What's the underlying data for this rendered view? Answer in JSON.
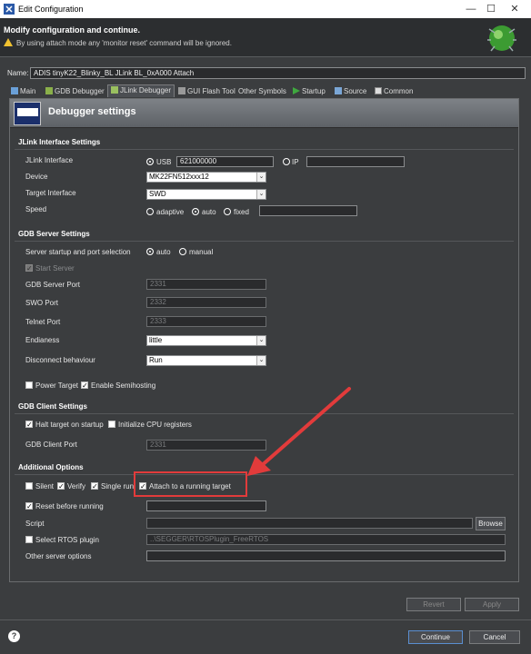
{
  "window": {
    "title": "Edit Configuration",
    "minimize": "—",
    "maximize": "☐",
    "close": "✕"
  },
  "header": {
    "title": "Modify configuration and continue.",
    "warning": "By using attach mode any 'monitor reset' command will be ignored."
  },
  "name": {
    "label": "Name:",
    "value": "ADIS tinyK22_Blinky_BL JLink BL_0xA000 Attach"
  },
  "tabs": [
    {
      "label": "Main"
    },
    {
      "label": "GDB Debugger"
    },
    {
      "label": "JLink Debugger",
      "active": true
    },
    {
      "label": "GUI Flash Tool"
    },
    {
      "label": "Other Symbols"
    },
    {
      "label": "Startup"
    },
    {
      "label": "Source"
    },
    {
      "label": "Common"
    }
  ],
  "banner": {
    "title": "Debugger settings",
    "logo_text": "SEGGER"
  },
  "jlink": {
    "section": "JLink Interface Settings",
    "interface_label": "JLink Interface",
    "usb": "USB",
    "usb_serial": "621000000",
    "ip": "IP",
    "device_label": "Device",
    "device": "MK22FN512xxx12",
    "target_iface_label": "Target Interface",
    "target_iface": "SWD",
    "speed_label": "Speed",
    "speed_adaptive": "adaptive",
    "speed_auto": "auto",
    "speed_fixed": "fixed"
  },
  "gdbserver": {
    "section": "GDB Server Settings",
    "startup_label": "Server startup and port selection",
    "auto": "auto",
    "manual": "manual",
    "start_server": "Start Server",
    "gdb_port_label": "GDB Server Port",
    "gdb_port": "2331",
    "swo_port_label": "SWO Port",
    "swo_port": "2332",
    "telnet_port_label": "Telnet Port",
    "telnet_port": "2333",
    "endianess_label": "Endianess",
    "endianess": "little",
    "disconnect_label": "Disconnect behaviour",
    "disconnect": "Run",
    "power_target": "Power Target",
    "semihosting": "Enable Semihosting"
  },
  "gdbclient": {
    "section": "GDB Client Settings",
    "halt": "Halt target on startup",
    "init_cpu": "Initialize CPU registers",
    "client_port_label": "GDB Client Port",
    "client_port": "2331"
  },
  "additional": {
    "section": "Additional Options",
    "silent": "Silent",
    "verify": "Verify",
    "single_run": "Single run",
    "attach": "Attach to a running target",
    "reset": "Reset before running",
    "script_label": "Script",
    "browse": "Browse",
    "rtos": "Select RTOS plugin",
    "rtos_value": "..\\SEGGER\\RTOSPlugin_FreeRTOS",
    "other_label": "Other server options"
  },
  "footer": {
    "revert": "Revert",
    "apply": "Apply",
    "continue": "Continue",
    "cancel": "Cancel",
    "help": "?"
  },
  "colors": {
    "annotation": "#e23b3b",
    "background": "#3b3d3f"
  }
}
